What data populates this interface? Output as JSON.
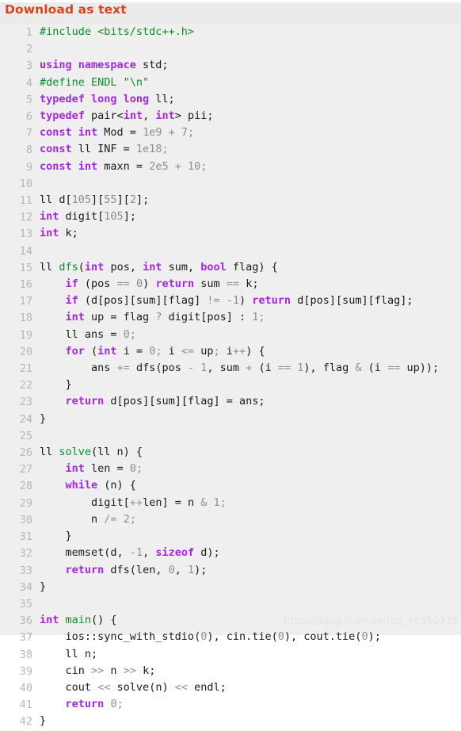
{
  "header": {
    "download_label": "Download as text",
    "accent_color": "#d9441f"
  },
  "watermark": {
    "text": "https://blog.csdn.net/qq_45550375",
    "color": "#e2e2e2"
  },
  "theme": {
    "background": "#ebebeb",
    "code_background": "#efefef",
    "line_number_color": "#b6b6b6",
    "keyword_color": "#a626e0",
    "function_color": "#0a8f28",
    "preprocessor_color": "#0a8f28",
    "string_color": "#0a8f28",
    "number_color": "#8e8e8e",
    "plain_color": "#1a1a1a"
  },
  "code": {
    "language": "cpp",
    "first_line_number": 1,
    "total_lines": 42,
    "line_numbers": [
      1,
      2,
      3,
      4,
      5,
      6,
      7,
      8,
      9,
      10,
      11,
      12,
      13,
      14,
      15,
      16,
      17,
      18,
      19,
      20,
      21,
      22,
      23,
      24,
      25,
      26,
      27,
      28,
      29,
      30,
      31,
      32,
      33,
      34,
      35,
      36,
      37,
      38,
      39,
      40,
      41,
      42
    ],
    "lines": [
      "#include <bits/stdc++.h>",
      "",
      "using namespace std;",
      "#define ENDL \"\\n\"",
      "typedef long long ll;",
      "typedef pair<int, int> pii;",
      "const int Mod = 1e9 + 7;",
      "const ll INF = 1e18;",
      "const int maxn = 2e5 + 10;",
      "",
      "ll d[105][55][2];",
      "int digit[105];",
      "int k;",
      "",
      "ll dfs(int pos, int sum, bool flag) {",
      "    if (pos == 0) return sum == k;",
      "    if (d[pos][sum][flag] != -1) return d[pos][sum][flag];",
      "    int up = flag ? digit[pos] : 1;",
      "    ll ans = 0;",
      "    for (int i = 0; i <= up; i++) {",
      "        ans += dfs(pos - 1, sum + (i == 1), flag & (i == up));",
      "    }",
      "    return d[pos][sum][flag] = ans;",
      "}",
      "",
      "ll solve(ll n) {",
      "    int len = 0;",
      "    while (n) {",
      "        digit[++len] = n & 1;",
      "        n /= 2;",
      "    }",
      "    memset(d, -1, sizeof d);",
      "    return dfs(len, 0, 1);",
      "}",
      "",
      "int main() {",
      "    ios::sync_with_stdio(0), cin.tie(0), cout.tie(0);",
      "    ll n;",
      "    cin >> n >> k;",
      "    cout << solve(n) << endl;",
      "    return 0;",
      "}"
    ],
    "tokens": [
      [
        [
          "pp",
          "#include <bits/stdc++.h>"
        ]
      ],
      [],
      [
        [
          "kw",
          "using namespace"
        ],
        [
          "pl",
          " std;"
        ]
      ],
      [
        [
          "pp",
          "#define ENDL \"\\n\""
        ]
      ],
      [
        [
          "kw",
          "typedef long long"
        ],
        [
          "pl",
          " ll;"
        ]
      ],
      [
        [
          "kw",
          "typedef"
        ],
        [
          "pl",
          " pair<"
        ],
        [
          "kw",
          "int"
        ],
        [
          "pl",
          ", "
        ],
        [
          "kw",
          "int"
        ],
        [
          "pl",
          "> pii;"
        ]
      ],
      [
        [
          "kw",
          "const int"
        ],
        [
          "pl",
          " Mod = "
        ],
        [
          "num",
          "1e9"
        ],
        [
          "op",
          " + "
        ],
        [
          "num",
          "7"
        ],
        [
          "op",
          ";"
        ]
      ],
      [
        [
          "kw",
          "const"
        ],
        [
          "pl",
          " ll INF = "
        ],
        [
          "num",
          "1e18"
        ],
        [
          "op",
          ";"
        ]
      ],
      [
        [
          "kw",
          "const int"
        ],
        [
          "pl",
          " maxn = "
        ],
        [
          "num",
          "2e5"
        ],
        [
          "op",
          " + "
        ],
        [
          "num",
          "10"
        ],
        [
          "op",
          ";"
        ]
      ],
      [],
      [
        [
          "pl",
          "ll d["
        ],
        [
          "num",
          "105"
        ],
        [
          "pl",
          "]["
        ],
        [
          "num",
          "55"
        ],
        [
          "pl",
          "]["
        ],
        [
          "num",
          "2"
        ],
        [
          "pl",
          "];"
        ]
      ],
      [
        [
          "kw",
          "int"
        ],
        [
          "pl",
          " digit["
        ],
        [
          "num",
          "105"
        ],
        [
          "pl",
          "];"
        ]
      ],
      [
        [
          "kw",
          "int"
        ],
        [
          "pl",
          " k;"
        ]
      ],
      [],
      [
        [
          "pl",
          "ll "
        ],
        [
          "fn",
          "dfs"
        ],
        [
          "pl",
          "("
        ],
        [
          "kw",
          "int"
        ],
        [
          "pl",
          " pos, "
        ],
        [
          "kw",
          "int"
        ],
        [
          "pl",
          " sum, "
        ],
        [
          "kw",
          "bool"
        ],
        [
          "pl",
          " flag) {"
        ]
      ],
      [
        [
          "pl",
          "    "
        ],
        [
          "kw",
          "if"
        ],
        [
          "pl",
          " (pos "
        ],
        [
          "op",
          "=="
        ],
        [
          "pl",
          " "
        ],
        [
          "num",
          "0"
        ],
        [
          "pl",
          ") "
        ],
        [
          "kw",
          "return"
        ],
        [
          "pl",
          " sum "
        ],
        [
          "op",
          "=="
        ],
        [
          "pl",
          " k;"
        ]
      ],
      [
        [
          "pl",
          "    "
        ],
        [
          "kw",
          "if"
        ],
        [
          "pl",
          " (d[pos][sum][flag] "
        ],
        [
          "op",
          "!="
        ],
        [
          "pl",
          " "
        ],
        [
          "op",
          "-"
        ],
        [
          "num",
          "1"
        ],
        [
          "pl",
          ") "
        ],
        [
          "kw",
          "return"
        ],
        [
          "pl",
          " d[pos][sum][flag];"
        ]
      ],
      [
        [
          "pl",
          "    "
        ],
        [
          "kw",
          "int"
        ],
        [
          "pl",
          " up = flag "
        ],
        [
          "op",
          "?"
        ],
        [
          "pl",
          " digit[pos] : "
        ],
        [
          "num",
          "1"
        ],
        [
          "op",
          ";"
        ]
      ],
      [
        [
          "pl",
          "    ll ans = "
        ],
        [
          "num",
          "0"
        ],
        [
          "op",
          ";"
        ]
      ],
      [
        [
          "pl",
          "    "
        ],
        [
          "kw",
          "for"
        ],
        [
          "pl",
          " ("
        ],
        [
          "kw",
          "int"
        ],
        [
          "pl",
          " i = "
        ],
        [
          "num",
          "0"
        ],
        [
          "op",
          "; "
        ],
        [
          "pl",
          "i "
        ],
        [
          "op",
          "<="
        ],
        [
          "pl",
          " up"
        ],
        [
          "op",
          "; "
        ],
        [
          "pl",
          "i"
        ],
        [
          "op",
          "++"
        ],
        [
          "pl",
          ") {"
        ]
      ],
      [
        [
          "pl",
          "        ans "
        ],
        [
          "op",
          "+="
        ],
        [
          "pl",
          " dfs(pos "
        ],
        [
          "op",
          "-"
        ],
        [
          "pl",
          " "
        ],
        [
          "num",
          "1"
        ],
        [
          "pl",
          ", sum "
        ],
        [
          "op",
          "+"
        ],
        [
          "pl",
          " (i "
        ],
        [
          "op",
          "=="
        ],
        [
          "pl",
          " "
        ],
        [
          "num",
          "1"
        ],
        [
          "pl",
          "), flag "
        ],
        [
          "op",
          "&"
        ],
        [
          "pl",
          " (i "
        ],
        [
          "op",
          "=="
        ],
        [
          "pl",
          " up));"
        ]
      ],
      [
        [
          "pl",
          "    }"
        ]
      ],
      [
        [
          "pl",
          "    "
        ],
        [
          "kw",
          "return"
        ],
        [
          "pl",
          " d[pos][sum][flag] = ans;"
        ]
      ],
      [
        [
          "pl",
          "}"
        ]
      ],
      [],
      [
        [
          "pl",
          "ll "
        ],
        [
          "fn",
          "solve"
        ],
        [
          "pl",
          "(ll n) {"
        ]
      ],
      [
        [
          "pl",
          "    "
        ],
        [
          "kw",
          "int"
        ],
        [
          "pl",
          " len = "
        ],
        [
          "num",
          "0"
        ],
        [
          "op",
          ";"
        ]
      ],
      [
        [
          "pl",
          "    "
        ],
        [
          "kw",
          "while"
        ],
        [
          "pl",
          " (n) {"
        ]
      ],
      [
        [
          "pl",
          "        digit["
        ],
        [
          "op",
          "++"
        ],
        [
          "pl",
          "len] = n "
        ],
        [
          "op",
          "&"
        ],
        [
          "pl",
          " "
        ],
        [
          "num",
          "1"
        ],
        [
          "op",
          ";"
        ]
      ],
      [
        [
          "pl",
          "        n "
        ],
        [
          "op",
          "/="
        ],
        [
          "pl",
          " "
        ],
        [
          "num",
          "2"
        ],
        [
          "op",
          ";"
        ]
      ],
      [
        [
          "pl",
          "    }"
        ]
      ],
      [
        [
          "pl",
          "    memset(d, "
        ],
        [
          "op",
          "-"
        ],
        [
          "num",
          "1"
        ],
        [
          "pl",
          ", "
        ],
        [
          "kw",
          "sizeof"
        ],
        [
          "pl",
          " d);"
        ]
      ],
      [
        [
          "pl",
          "    "
        ],
        [
          "kw",
          "return"
        ],
        [
          "pl",
          " dfs(len, "
        ],
        [
          "num",
          "0"
        ],
        [
          "pl",
          ", "
        ],
        [
          "num",
          "1"
        ],
        [
          "pl",
          ");"
        ]
      ],
      [
        [
          "pl",
          "}"
        ]
      ],
      [],
      [
        [
          "kw",
          "int"
        ],
        [
          "pl",
          " "
        ],
        [
          "fn",
          "main"
        ],
        [
          "pl",
          "() {"
        ]
      ],
      [
        [
          "pl",
          "    ios::sync_with_stdio("
        ],
        [
          "num",
          "0"
        ],
        [
          "pl",
          "), cin.tie("
        ],
        [
          "num",
          "0"
        ],
        [
          "pl",
          "), cout.tie("
        ],
        [
          "num",
          "0"
        ],
        [
          "pl",
          ");"
        ]
      ],
      [
        [
          "pl",
          "    ll n;"
        ]
      ],
      [
        [
          "pl",
          "    cin "
        ],
        [
          "op",
          ">>"
        ],
        [
          "pl",
          " n "
        ],
        [
          "op",
          ">>"
        ],
        [
          "pl",
          " k;"
        ]
      ],
      [
        [
          "pl",
          "    cout "
        ],
        [
          "op",
          "<<"
        ],
        [
          "pl",
          " solve(n) "
        ],
        [
          "op",
          "<<"
        ],
        [
          "pl",
          " endl;"
        ]
      ],
      [
        [
          "pl",
          "    "
        ],
        [
          "kw",
          "return"
        ],
        [
          "pl",
          " "
        ],
        [
          "num",
          "0"
        ],
        [
          "op",
          ";"
        ]
      ],
      [
        [
          "pl",
          "}"
        ]
      ]
    ]
  }
}
